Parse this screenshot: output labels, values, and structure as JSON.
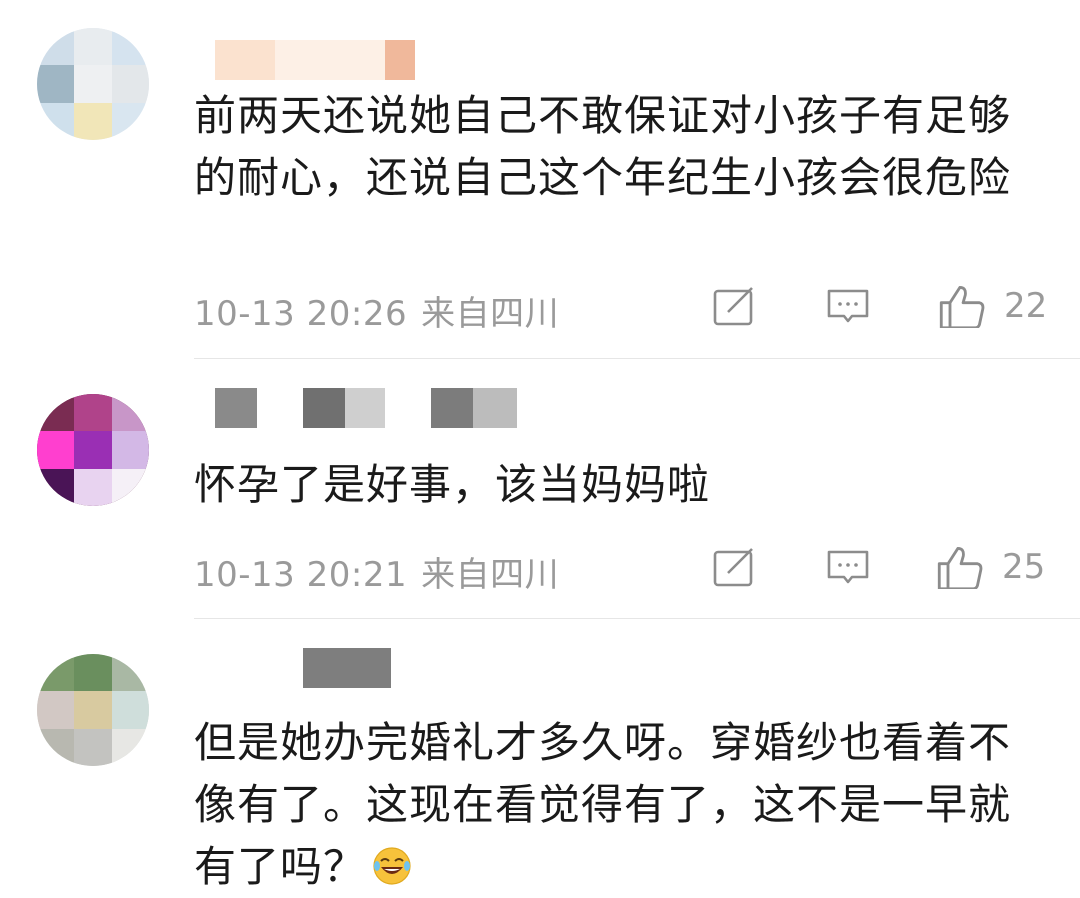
{
  "comments": [
    {
      "text": "前两天还说她自己不敢保证对小孩子有足够的耐心，还说自己这个年纪生小孩会很危险",
      "time": "10-13 20:26",
      "location": "来自四川",
      "likes": "22"
    },
    {
      "text": "怀孕了是好事，该当妈妈啦",
      "time": "10-13 20:21",
      "location": "来自四川",
      "likes": "25"
    },
    {
      "text": "但是她办完婚礼才多久呀。穿婚纱也看着不像有了。这现在看觉得有了，这不是一早就有了吗？",
      "time": "",
      "location": "",
      "likes": ""
    }
  ],
  "icons": {
    "share": "share-icon",
    "comment": "comment-icon",
    "like": "thumbs-up-icon",
    "emoji": "laughing-tears-emoji-icon"
  },
  "colors": {
    "meta_text": "#9a9a9a",
    "body_text": "#1a1a1a",
    "divider": "#e6e6e6"
  }
}
